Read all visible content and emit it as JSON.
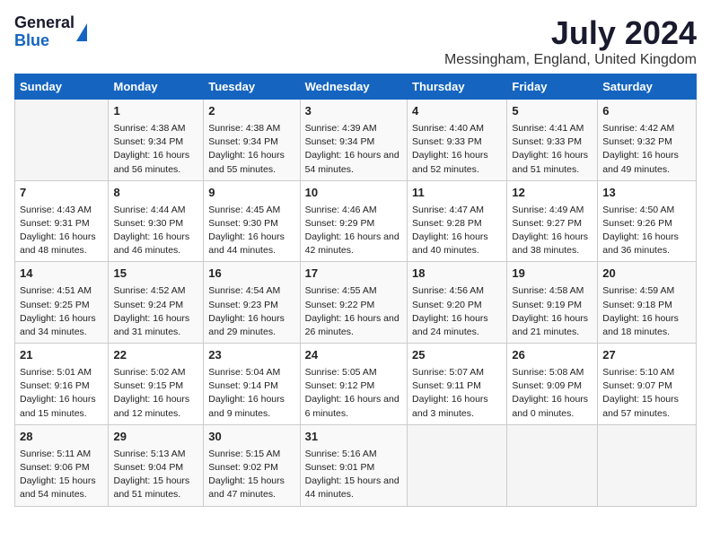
{
  "logo": {
    "general": "General",
    "blue": "Blue"
  },
  "title": "July 2024",
  "location": "Messingham, England, United Kingdom",
  "days_of_week": [
    "Sunday",
    "Monday",
    "Tuesday",
    "Wednesday",
    "Thursday",
    "Friday",
    "Saturday"
  ],
  "weeks": [
    [
      {
        "day": "",
        "info": ""
      },
      {
        "day": "1",
        "info": "Sunrise: 4:38 AM\nSunset: 9:34 PM\nDaylight: 16 hours and 56 minutes."
      },
      {
        "day": "2",
        "info": "Sunrise: 4:38 AM\nSunset: 9:34 PM\nDaylight: 16 hours and 55 minutes."
      },
      {
        "day": "3",
        "info": "Sunrise: 4:39 AM\nSunset: 9:34 PM\nDaylight: 16 hours and 54 minutes."
      },
      {
        "day": "4",
        "info": "Sunrise: 4:40 AM\nSunset: 9:33 PM\nDaylight: 16 hours and 52 minutes."
      },
      {
        "day": "5",
        "info": "Sunrise: 4:41 AM\nSunset: 9:33 PM\nDaylight: 16 hours and 51 minutes."
      },
      {
        "day": "6",
        "info": "Sunrise: 4:42 AM\nSunset: 9:32 PM\nDaylight: 16 hours and 49 minutes."
      }
    ],
    [
      {
        "day": "7",
        "info": "Sunrise: 4:43 AM\nSunset: 9:31 PM\nDaylight: 16 hours and 48 minutes."
      },
      {
        "day": "8",
        "info": "Sunrise: 4:44 AM\nSunset: 9:30 PM\nDaylight: 16 hours and 46 minutes."
      },
      {
        "day": "9",
        "info": "Sunrise: 4:45 AM\nSunset: 9:30 PM\nDaylight: 16 hours and 44 minutes."
      },
      {
        "day": "10",
        "info": "Sunrise: 4:46 AM\nSunset: 9:29 PM\nDaylight: 16 hours and 42 minutes."
      },
      {
        "day": "11",
        "info": "Sunrise: 4:47 AM\nSunset: 9:28 PM\nDaylight: 16 hours and 40 minutes."
      },
      {
        "day": "12",
        "info": "Sunrise: 4:49 AM\nSunset: 9:27 PM\nDaylight: 16 hours and 38 minutes."
      },
      {
        "day": "13",
        "info": "Sunrise: 4:50 AM\nSunset: 9:26 PM\nDaylight: 16 hours and 36 minutes."
      }
    ],
    [
      {
        "day": "14",
        "info": "Sunrise: 4:51 AM\nSunset: 9:25 PM\nDaylight: 16 hours and 34 minutes."
      },
      {
        "day": "15",
        "info": "Sunrise: 4:52 AM\nSunset: 9:24 PM\nDaylight: 16 hours and 31 minutes."
      },
      {
        "day": "16",
        "info": "Sunrise: 4:54 AM\nSunset: 9:23 PM\nDaylight: 16 hours and 29 minutes."
      },
      {
        "day": "17",
        "info": "Sunrise: 4:55 AM\nSunset: 9:22 PM\nDaylight: 16 hours and 26 minutes."
      },
      {
        "day": "18",
        "info": "Sunrise: 4:56 AM\nSunset: 9:20 PM\nDaylight: 16 hours and 24 minutes."
      },
      {
        "day": "19",
        "info": "Sunrise: 4:58 AM\nSunset: 9:19 PM\nDaylight: 16 hours and 21 minutes."
      },
      {
        "day": "20",
        "info": "Sunrise: 4:59 AM\nSunset: 9:18 PM\nDaylight: 16 hours and 18 minutes."
      }
    ],
    [
      {
        "day": "21",
        "info": "Sunrise: 5:01 AM\nSunset: 9:16 PM\nDaylight: 16 hours and 15 minutes."
      },
      {
        "day": "22",
        "info": "Sunrise: 5:02 AM\nSunset: 9:15 PM\nDaylight: 16 hours and 12 minutes."
      },
      {
        "day": "23",
        "info": "Sunrise: 5:04 AM\nSunset: 9:14 PM\nDaylight: 16 hours and 9 minutes."
      },
      {
        "day": "24",
        "info": "Sunrise: 5:05 AM\nSunset: 9:12 PM\nDaylight: 16 hours and 6 minutes."
      },
      {
        "day": "25",
        "info": "Sunrise: 5:07 AM\nSunset: 9:11 PM\nDaylight: 16 hours and 3 minutes."
      },
      {
        "day": "26",
        "info": "Sunrise: 5:08 AM\nSunset: 9:09 PM\nDaylight: 16 hours and 0 minutes."
      },
      {
        "day": "27",
        "info": "Sunrise: 5:10 AM\nSunset: 9:07 PM\nDaylight: 15 hours and 57 minutes."
      }
    ],
    [
      {
        "day": "28",
        "info": "Sunrise: 5:11 AM\nSunset: 9:06 PM\nDaylight: 15 hours and 54 minutes."
      },
      {
        "day": "29",
        "info": "Sunrise: 5:13 AM\nSunset: 9:04 PM\nDaylight: 15 hours and 51 minutes."
      },
      {
        "day": "30",
        "info": "Sunrise: 5:15 AM\nSunset: 9:02 PM\nDaylight: 15 hours and 47 minutes."
      },
      {
        "day": "31",
        "info": "Sunrise: 5:16 AM\nSunset: 9:01 PM\nDaylight: 15 hours and 44 minutes."
      },
      {
        "day": "",
        "info": ""
      },
      {
        "day": "",
        "info": ""
      },
      {
        "day": "",
        "info": ""
      }
    ]
  ]
}
